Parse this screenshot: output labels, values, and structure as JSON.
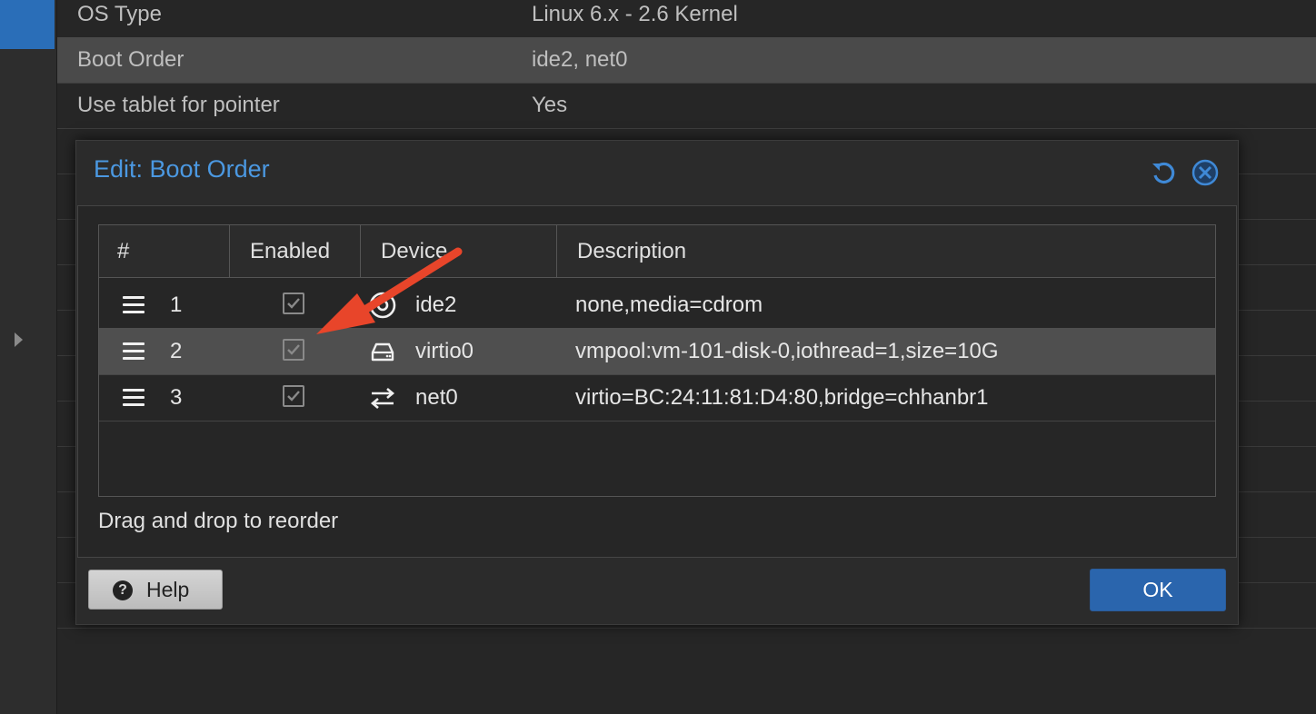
{
  "background": {
    "rows": [
      {
        "key": "OS Type",
        "value": "Linux 6.x - 2.6 Kernel"
      },
      {
        "key": "Boot Order",
        "value": "ide2, net0"
      },
      {
        "key": "Use tablet for pointer",
        "value": "Yes"
      }
    ]
  },
  "dialog": {
    "title": "Edit: Boot Order",
    "columns": [
      "#",
      "Enabled",
      "Device",
      "Description"
    ],
    "rows": [
      {
        "num": "1",
        "device": "ide2",
        "description": "none,media=cdrom",
        "icon": "cdrom-icon",
        "enabled": true
      },
      {
        "num": "2",
        "device": "virtio0",
        "description": "vmpool:vm-101-disk-0,iothread=1,size=10G",
        "icon": "harddisk-icon",
        "enabled": true
      },
      {
        "num": "3",
        "device": "net0",
        "description": "virtio=BC:24:11:81:D4:80,bridge=chhanbr1",
        "icon": "network-exchange-icon",
        "enabled": true
      }
    ],
    "hint": "Drag and drop to reorder",
    "help_label": "Help",
    "ok_label": "OK"
  },
  "colors": {
    "accent": "#4b98e1",
    "ok_button": "#2a65ad",
    "annotation_arrow": "#e8452a"
  }
}
